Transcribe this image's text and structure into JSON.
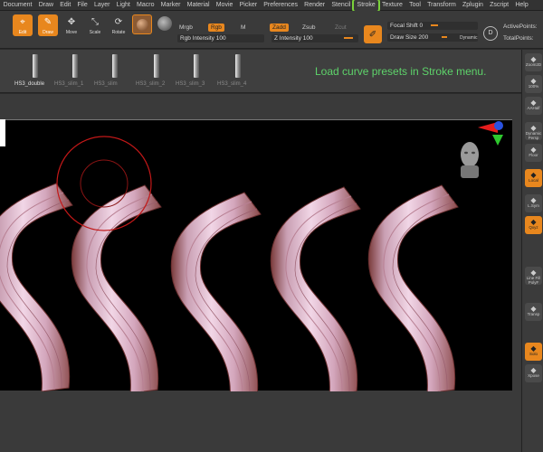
{
  "menu": [
    "Document",
    "Draw",
    "Edit",
    "File",
    "Layer",
    "Light",
    "Macro",
    "Marker",
    "Material",
    "Movie",
    "Picker",
    "Preferences",
    "Render",
    "Stencil",
    "Stroke",
    "Texture",
    "Tool",
    "Transform",
    "Zplugin",
    "Zscript",
    "Help"
  ],
  "menu_highlight": "Stroke",
  "toolbar": {
    "edit": "Edit",
    "draw": "Draw",
    "move": "Move",
    "scale": "Scale",
    "rotate": "Rotate",
    "mrgb": "Mrgb",
    "rgb": "Rgb",
    "m": "M",
    "rgb_intensity": "Rgb Intensity 100",
    "zadd": "Zadd",
    "zsub": "Zsub",
    "zcut": "Zcut",
    "z_intensity": "Z Intensity 100",
    "focal_shift": "Focal Shift 0",
    "draw_size": "Draw Size 200",
    "dynamic": "Dynamic",
    "active_points": "ActivePoints:",
    "total_points": "TotalPoints:"
  },
  "shelf": {
    "brushes": [
      "HS3_double",
      "HS3_slim_1",
      "HS3_slim",
      "HS3_slim_2",
      "HS3_slim_3",
      "HS3_slim_4"
    ],
    "hint": "Load curve presets in Stroke menu."
  },
  "rightbar": [
    {
      "label": "Zoom2D",
      "on": false
    },
    {
      "label": "100%",
      "on": false
    },
    {
      "label": "AAHalf",
      "on": false
    },
    {
      "label": "Dynamic Persp",
      "on": false
    },
    {
      "label": "Floor",
      "on": false
    },
    {
      "label": "Local",
      "on": true
    },
    {
      "label": "L.Sym",
      "on": false
    },
    {
      "label": "Qxyz",
      "on": true
    },
    {
      "label": "Line Fill PolyF",
      "on": false
    },
    {
      "label": "Transp",
      "on": false
    },
    {
      "label": "Solo",
      "on": true
    },
    {
      "label": "Xpose",
      "on": false
    }
  ],
  "colors": {
    "accent": "#e8871e",
    "hint": "#5ed36a",
    "highlight": "#7ad23a",
    "mesh": "#d7a8b8"
  }
}
